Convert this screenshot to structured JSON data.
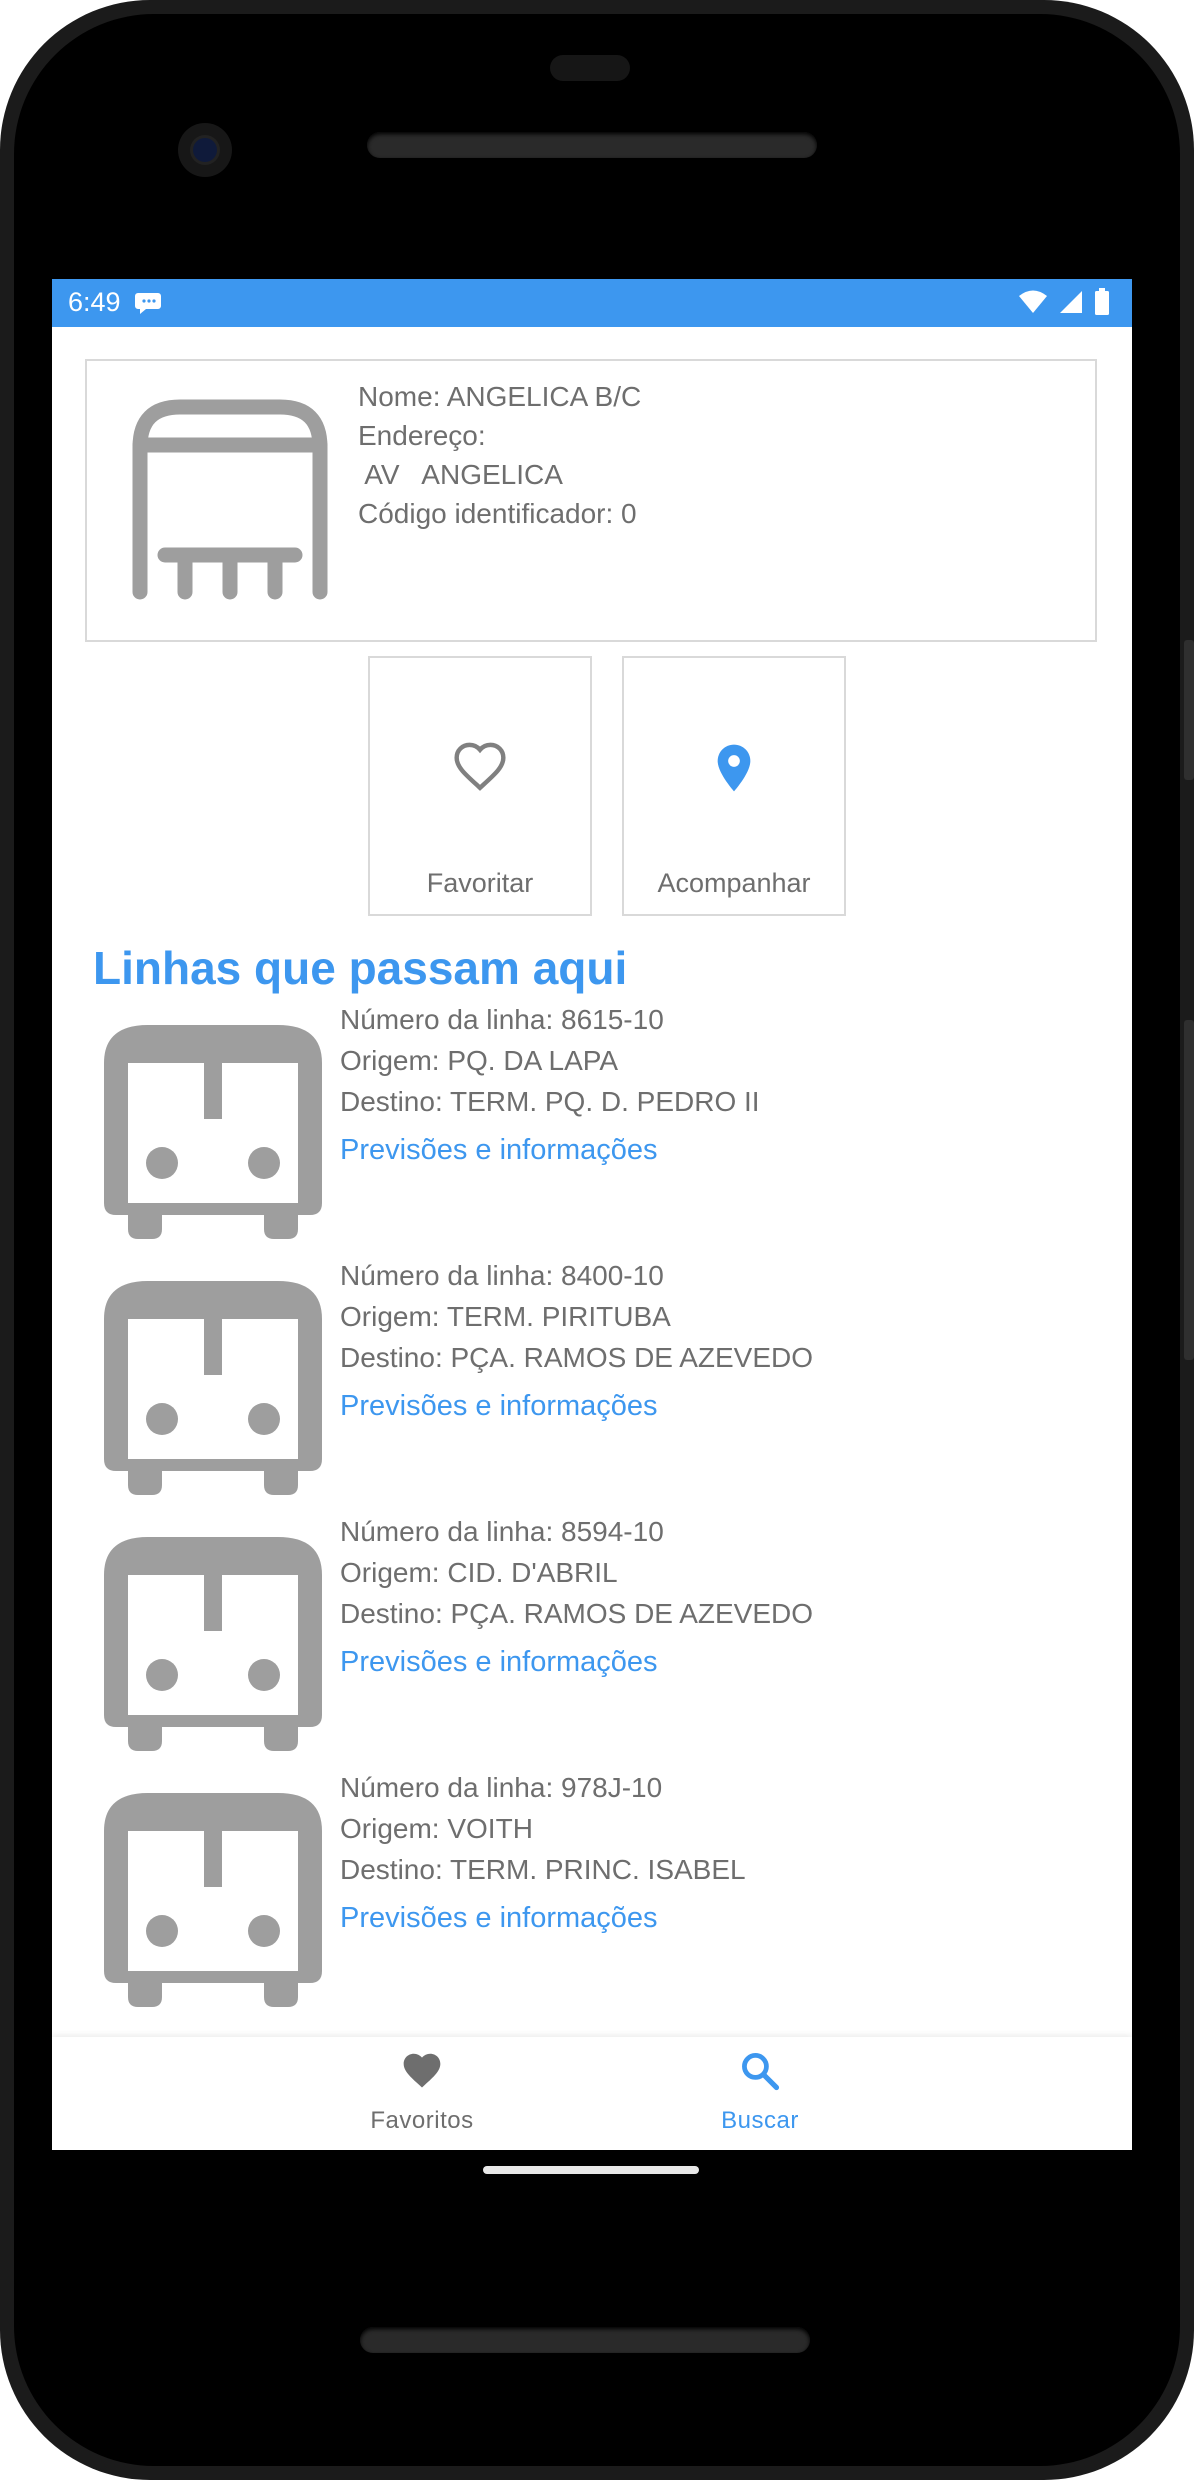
{
  "status_bar": {
    "time": "6:49",
    "icons": [
      "message-icon",
      "wifi-icon",
      "signal-icon",
      "battery-icon"
    ]
  },
  "stop": {
    "name": "Nome: ANGELICA B/C",
    "address_label": "Endereço:",
    "address": " AV   ANGELICA",
    "code": "Código identificador: 0",
    "icon": "bus-stop-icon"
  },
  "actions": {
    "favorite_label": "Favoritar",
    "track_label": "Acompanhar",
    "favorite_icon": "heart-outline-icon",
    "track_icon": "map-pin-icon"
  },
  "section_title": "Linhas que passam aqui",
  "lines": [
    {
      "number": "Número da linha: 8615-10",
      "origin": "Origem: PQ. DA LAPA",
      "destination": "Destino: TERM. PQ. D. PEDRO II",
      "link": "Previsões e informações"
    },
    {
      "number": "Número da linha: 8400-10",
      "origin": "Origem: TERM. PIRITUBA",
      "destination": "Destino: PÇA. RAMOS DE AZEVEDO",
      "link": "Previsões e informações"
    },
    {
      "number": "Número da linha: 8594-10",
      "origin": "Origem: CID. D'ABRIL",
      "destination": "Destino: PÇA. RAMOS DE AZEVEDO",
      "link": "Previsões e informações"
    },
    {
      "number": "Número da linha: 978J-10",
      "origin": "Origem: VOITH",
      "destination": "Destino: TERM. PRINC. ISABEL",
      "link": "Previsões e informações"
    }
  ],
  "bottom_nav": {
    "favorites_label": "Favoritos",
    "search_label": "Buscar",
    "active": "Buscar"
  },
  "colors": {
    "accent": "#3d97ef",
    "text_gray": "#6e6e6e",
    "icon_gray": "#9e9e9e",
    "border": "#d9d9d9"
  }
}
